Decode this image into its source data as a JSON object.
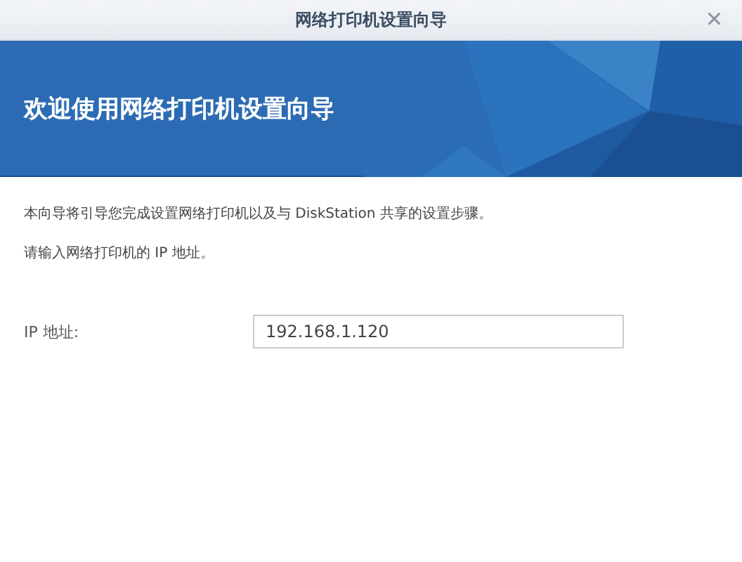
{
  "window": {
    "title": "网络打印机设置向导",
    "close": "×"
  },
  "banner": {
    "heading": "欢迎使用网络打印机设置向导"
  },
  "paragraphs": [
    "本向导将引导您完成设置网络打印机以及与 DiskStation 共享的设置步骤。",
    "请输入网络打印机的 IP 地址。"
  ],
  "ip_field": {
    "label": "IP 地址:",
    "value": "192.168.1.120"
  }
}
